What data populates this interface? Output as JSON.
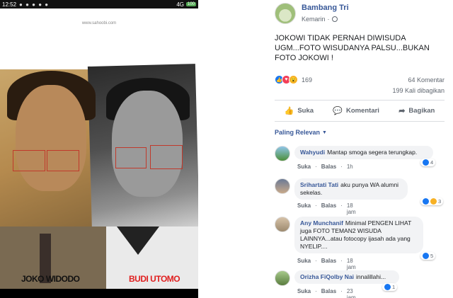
{
  "statusbar": {
    "time": "12:52",
    "signal": "4G",
    "battery": "100"
  },
  "photo": {
    "watermark": "www.sahoobi.com",
    "label_left": "JOKO WIDODO",
    "label_right": "BUDI UTOMO"
  },
  "post": {
    "author": "Bambang Tri",
    "time": "Kemarin",
    "text": "JOKOWI TIDAK PERNAH DIWISUDA UGM...FOTO WISUDANYA PALSU...BUKAN FOTO JOKOWI !",
    "reaction_count": "169",
    "comments_count": "64 Komentar",
    "shares_count": "199 Kali dibagikan",
    "actions": {
      "like": "Suka",
      "comment": "Komentari",
      "share": "Bagikan"
    },
    "sort_label": "Paling Relevan",
    "colors": {
      "link": "#385898",
      "like": "#1877f2",
      "love": "#f33e58",
      "wow": "#f7b125"
    }
  },
  "comments": [
    {
      "name": "Wahyudi",
      "text": "Mantap smoga segera terungkap.",
      "like": "Suka",
      "reply": "Balas",
      "time": "1h",
      "reactions": "4"
    },
    {
      "name": "Srihartati Tati",
      "text": "aku punya WA alumni sekelas.",
      "like": "Suka",
      "reply": "Balas",
      "time": "18 jam",
      "reactions": "3"
    },
    {
      "name": "Any Munchanif",
      "text": "Minimal PENGEN LIHAT juga FOTO TEMAN2 WISUDA LAINNYA...atau fotocopy ijasah ada yang NYELIP....",
      "like": "Suka",
      "reply": "Balas",
      "time": "18 jam",
      "reactions": "5"
    },
    {
      "name": "Orizha FiQolby Nai",
      "text": "innalillahi...",
      "like": "Suka",
      "reply": "Balas",
      "time": "23 jam",
      "reactions": "1"
    }
  ]
}
